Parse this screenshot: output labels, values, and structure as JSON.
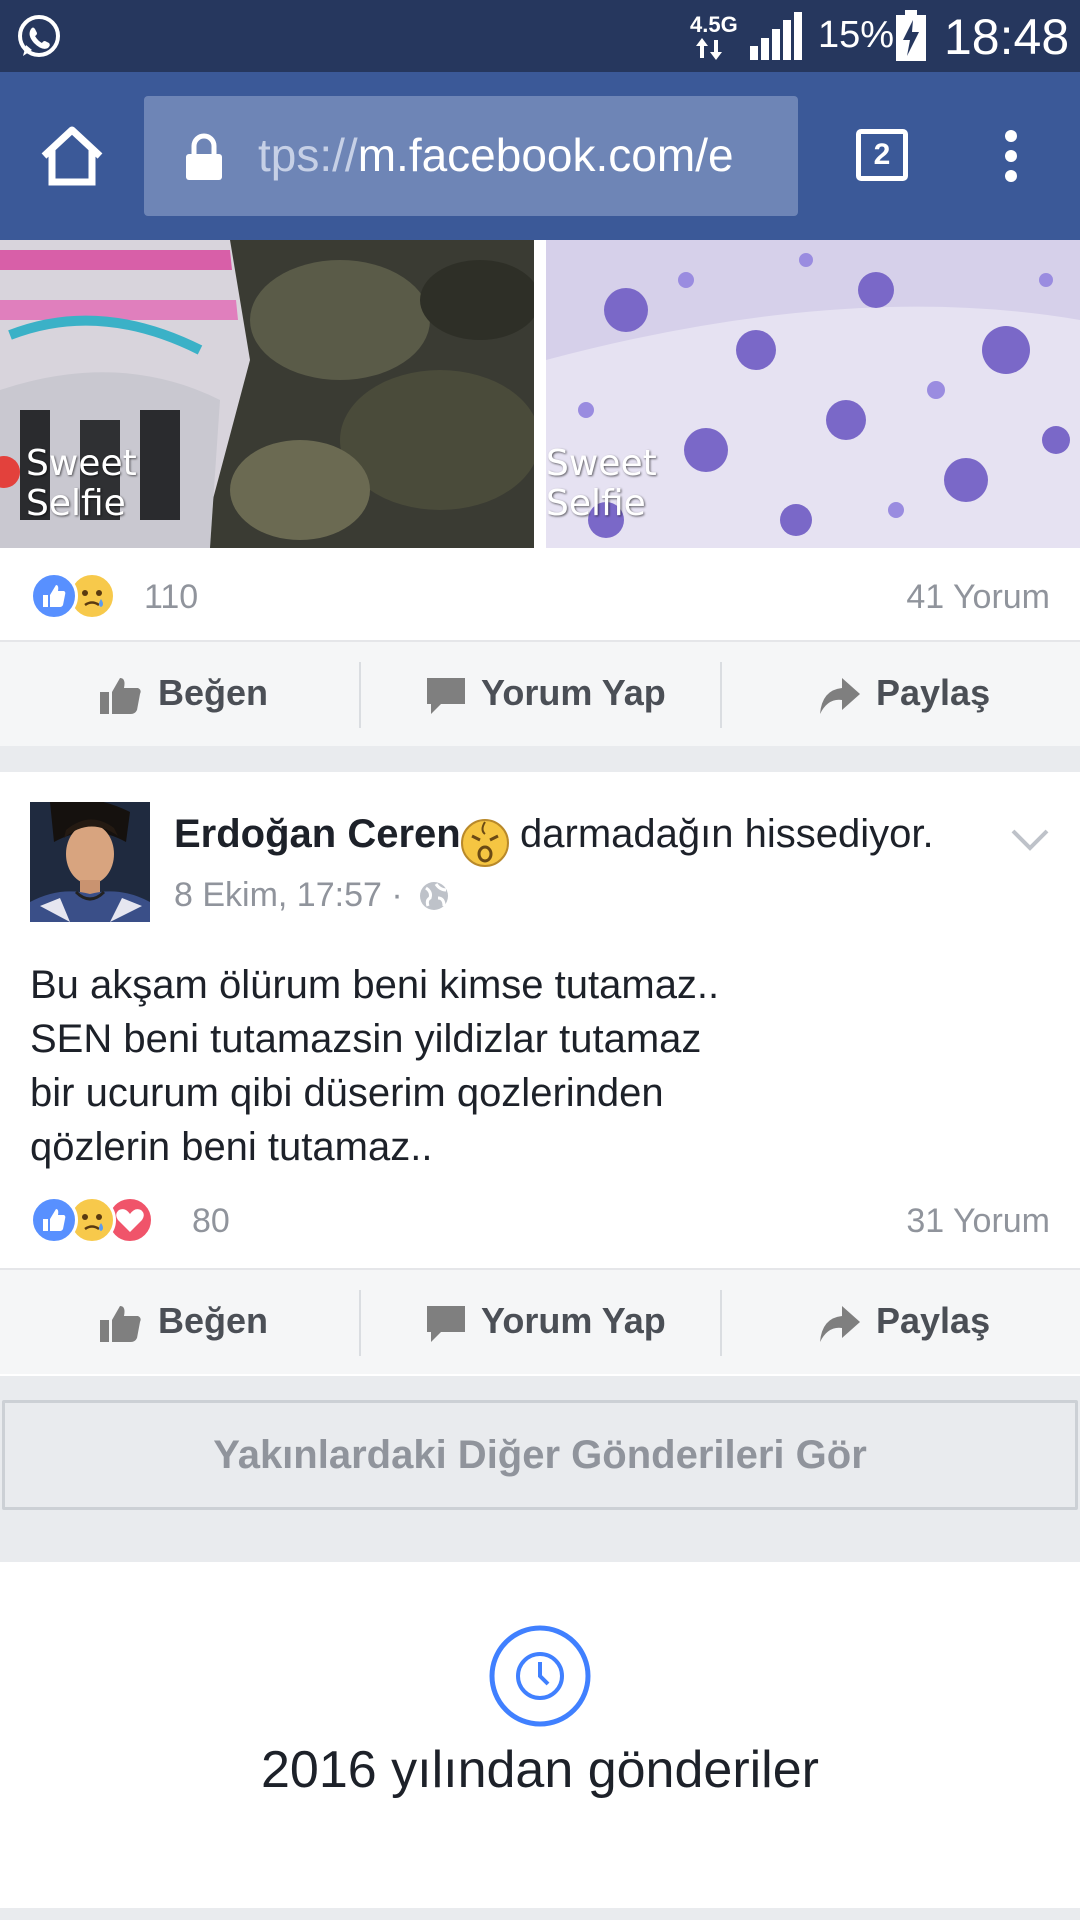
{
  "status_bar": {
    "network": "4.5G",
    "battery_percent": "15%",
    "time": "18:48",
    "icons": [
      "whatsapp-icon",
      "signal-icon",
      "battery-charging-icon"
    ]
  },
  "browser": {
    "url_scheme": "tps://",
    "url_host": "m.facebook.com/e",
    "tab_count": "2",
    "icons": [
      "home-icon",
      "lock-icon",
      "overflow-menu-icon"
    ]
  },
  "photos": {
    "left_caption_line1": "Sweet",
    "left_caption_line2": "Selfie",
    "right_caption_line1": "Sweet",
    "right_caption_line2": "Selfie"
  },
  "prev_post": {
    "reaction_count": "110",
    "comment_count": "41 Yorum",
    "reactions": [
      "like",
      "sad"
    ]
  },
  "actions": {
    "like": "Beğen",
    "comment": "Yorum Yap",
    "share": "Paylaş"
  },
  "post": {
    "author": "Erdoğan Ceren",
    "feeling": "darmadağın hissediyor.",
    "timestamp": "8 Ekim, 17:57 ·",
    "lines": [
      "Bu akşam ölürum beni kimse tutamaz..",
      "SEN beni tutamazsin yildizlar tutamaz",
      "bir ucurum qibi düserim qozlerinden",
      "qözlerin beni tutamaz.."
    ],
    "reaction_count": "80",
    "comment_count": "31 Yorum",
    "reactions": [
      "like",
      "sad",
      "love"
    ]
  },
  "see_more_label": "Yakınlardaki Diğer Gönderileri Gör",
  "year_section_title": "2016 yılından gönderiler",
  "colors": {
    "status_bar": "#26375e",
    "browser_bar": "#3b5998",
    "url_box": "#6e85b6",
    "like_blue": "#5890ff",
    "sad_yellow": "#f7c94b",
    "love_red": "#f0546a",
    "clock_blue": "#4080ff"
  }
}
